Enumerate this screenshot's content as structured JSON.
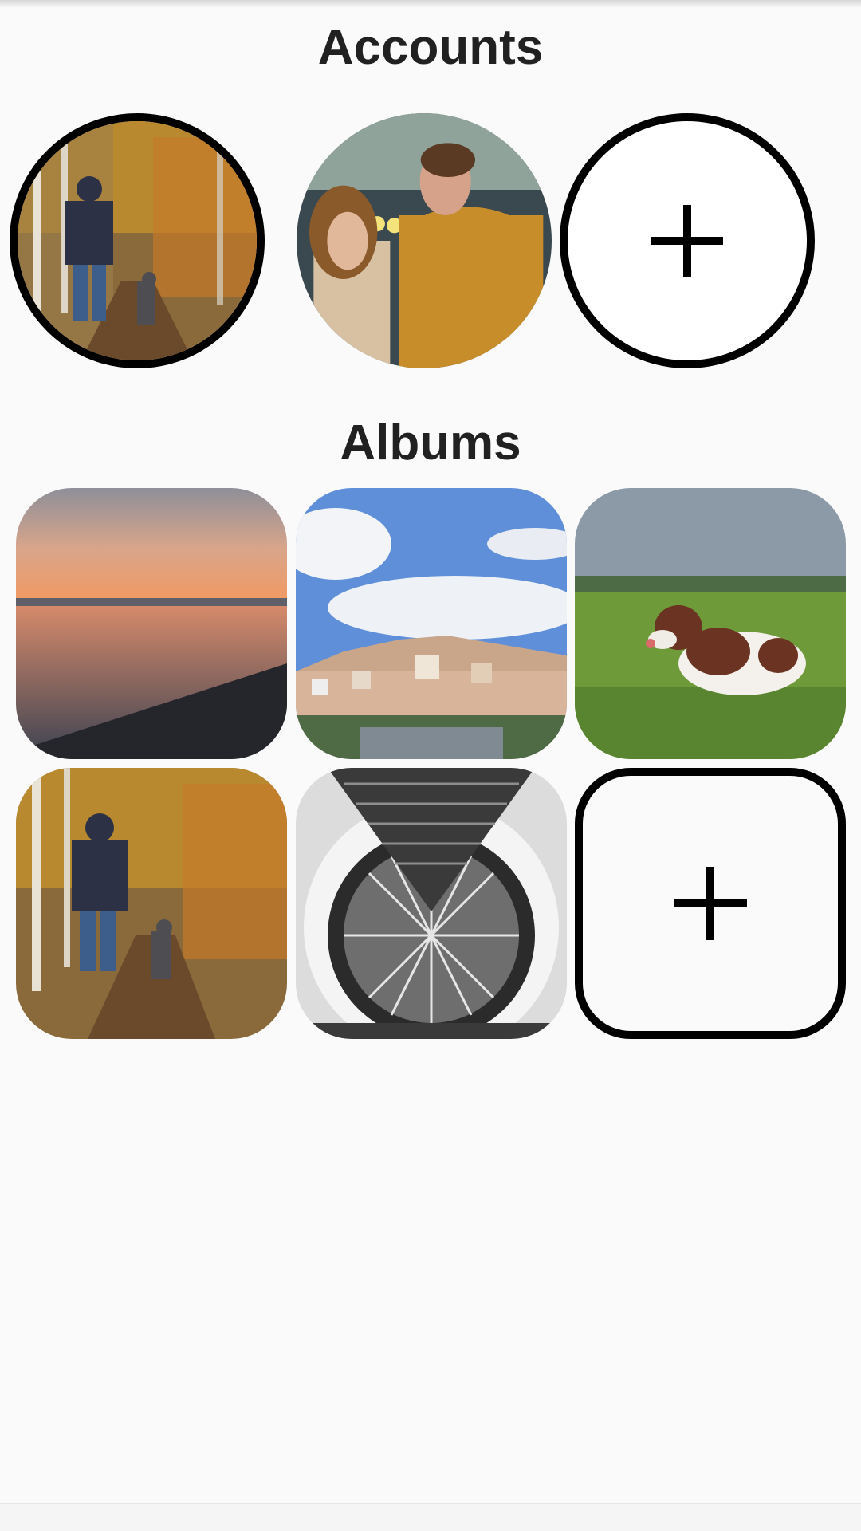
{
  "accounts": {
    "title": "Accounts",
    "items": [
      {
        "name": "account-forest-walk",
        "selected": true,
        "photo": "person-and-dog-autumn-path"
      },
      {
        "name": "account-couple",
        "selected": false,
        "photo": "couple-in-city"
      }
    ],
    "add_icon": "plus-icon"
  },
  "albums": {
    "title": "Albums",
    "items": [
      {
        "photo": "sunset-lake"
      },
      {
        "photo": "hillside-city-blue-sky"
      },
      {
        "photo": "spaniel-in-meadow"
      },
      {
        "photo": "person-and-dog-autumn-path"
      },
      {
        "photo": "glass-dome-interior"
      }
    ],
    "add_icon": "plus-icon"
  },
  "colors": {
    "background": "#fafafa",
    "title_text": "#212121",
    "outline": "#000000"
  }
}
